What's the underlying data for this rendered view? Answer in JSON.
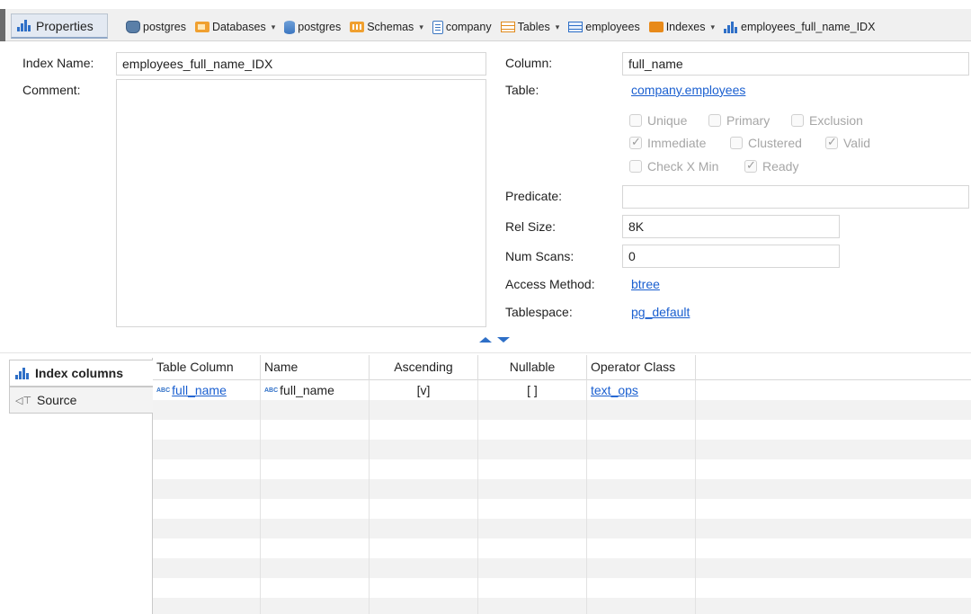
{
  "topbar": {
    "properties_tab": "Properties",
    "breadcrumbs": [
      {
        "label": "postgres",
        "icon": "postgres-server-icon",
        "dropdown": false
      },
      {
        "label": "Databases",
        "icon": "folder-icon",
        "dropdown": true
      },
      {
        "label": "postgres",
        "icon": "database-icon",
        "dropdown": false
      },
      {
        "label": "Schemas",
        "icon": "schemas-icon",
        "dropdown": true
      },
      {
        "label": "company",
        "icon": "schema-icon",
        "dropdown": false
      },
      {
        "label": "Tables",
        "icon": "tables-icon",
        "dropdown": true
      },
      {
        "label": "employees",
        "icon": "table-icon",
        "dropdown": false
      },
      {
        "label": "Indexes",
        "icon": "indexes-folder-icon",
        "dropdown": true
      },
      {
        "label": "employees_full_name_IDX",
        "icon": "index-icon",
        "dropdown": false
      }
    ]
  },
  "form": {
    "index_name_label": "Index Name:",
    "index_name_value": "employees_full_name_IDX",
    "comment_label": "Comment:",
    "comment_value": "",
    "column_label": "Column:",
    "column_value": "full_name",
    "table_label": "Table:",
    "table_value": "company.employees",
    "checkboxes": {
      "unique": {
        "label": "Unique",
        "checked": false
      },
      "primary": {
        "label": "Primary",
        "checked": false
      },
      "exclusion": {
        "label": "Exclusion",
        "checked": false
      },
      "immediate": {
        "label": "Immediate",
        "checked": true
      },
      "clustered": {
        "label": "Clustered",
        "checked": false
      },
      "valid": {
        "label": "Valid",
        "checked": true
      },
      "check_x_min": {
        "label": "Check X Min",
        "checked": false
      },
      "ready": {
        "label": "Ready",
        "checked": true
      }
    },
    "predicate_label": "Predicate:",
    "predicate_value": "",
    "rel_size_label": "Rel Size:",
    "rel_size_value": "8K",
    "num_scans_label": "Num Scans:",
    "num_scans_value": "0",
    "access_method_label": "Access Method:",
    "access_method_value": "btree",
    "tablespace_label": "Tablespace:",
    "tablespace_value": "pg_default"
  },
  "sidebar": {
    "tabs": [
      {
        "label": "Index columns",
        "icon": "index-icon",
        "active": true
      },
      {
        "label": "Source",
        "icon": "source-icon",
        "active": false
      }
    ]
  },
  "grid": {
    "columns": [
      "Table Column",
      "Name",
      "Ascending",
      "Nullable",
      "Operator Class"
    ],
    "rows": [
      {
        "table_column": "full_name",
        "name": "full_name",
        "ascending": "[v]",
        "nullable": "[ ]",
        "operator_class": "text_ops"
      }
    ]
  },
  "colors": {
    "accent": "#2e6fc7",
    "link": "#1a5fd0",
    "stripe": "#f2f2f2"
  }
}
